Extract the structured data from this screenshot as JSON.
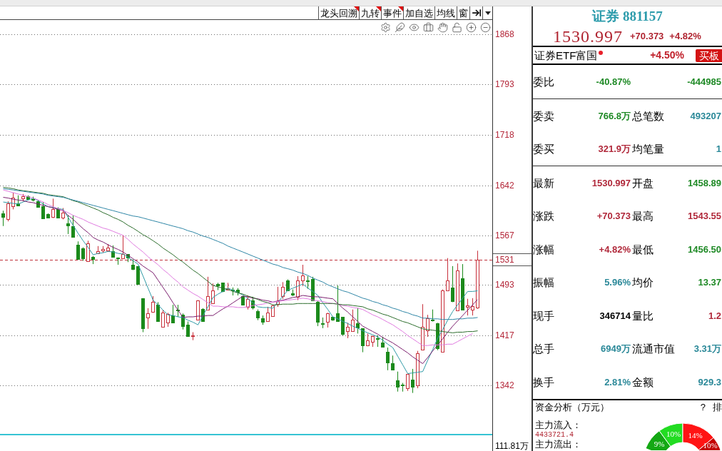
{
  "toolbar": [
    {
      "label": "龙头回溯",
      "corner_mark": true
    },
    {
      "label": "九转",
      "corner_mark": true
    },
    {
      "label": "事件",
      "corner_mark": true
    },
    {
      "label": "加自选",
      "corner_mark": false
    },
    {
      "label": "均线",
      "corner_mark": false
    },
    {
      "label": "窗",
      "corner_mark": false
    }
  ],
  "chart": {
    "chart_data": [
      {
        "type": "candlestick",
        "categories": [
          null,
          null,
          null,
          null,
          null,
          null,
          null,
          null,
          null,
          null,
          null,
          null,
          null,
          null,
          null,
          null,
          null,
          null,
          null,
          null,
          null,
          null,
          null,
          null,
          null,
          null,
          null,
          null,
          null,
          null,
          null,
          null,
          null,
          null,
          null,
          null,
          null,
          null,
          null,
          null,
          null,
          null,
          null,
          null,
          null,
          null,
          null,
          null,
          null,
          null,
          null,
          null,
          null,
          null,
          null,
          null,
          null,
          null,
          null,
          null,
          null,
          null,
          null,
          null,
          null,
          null,
          null,
          null,
          null,
          null,
          null,
          null,
          null,
          null,
          null,
          null,
          null,
          null,
          null,
          null,
          null,
          null,
          null,
          null,
          null,
          null,
          null,
          null,
          null,
          null,
          null,
          null,
          null,
          null,
          null,
          null
        ],
        "ylim": [
          1244,
          1910
        ],
        "yticks": [
          1342,
          1417,
          1493,
          1567,
          1642,
          1718,
          1793,
          1868
        ],
        "grid": true,
        "ohlc": [
          [
            1600,
            1604,
            1581,
            1595
          ],
          [
            1591,
            1618,
            1588,
            1615
          ],
          [
            1611,
            1631,
            1606,
            1623
          ],
          [
            1615,
            1627,
            1612,
            1612
          ],
          [
            1622,
            1629,
            1618,
            1626
          ],
          [
            1626,
            1627,
            1620,
            1621
          ],
          [
            1621,
            1625,
            1618,
            1620
          ],
          [
            1618,
            1620,
            1609,
            1610
          ],
          [
            1611,
            1617,
            1592,
            1592
          ],
          [
            1599,
            1600,
            1593,
            1594
          ],
          [
            1595,
            1622,
            1593,
            1606
          ],
          [
            1608,
            1609,
            1593,
            1594
          ],
          [
            1594,
            1608,
            1591,
            1601
          ],
          [
            1585,
            1597,
            1569,
            1582
          ],
          [
            1581,
            1597,
            1565,
            1565
          ],
          [
            1553,
            1558,
            1531,
            1532
          ],
          [
            1548,
            1549,
            1529,
            1533
          ],
          [
            1528,
            1559,
            1528,
            1555
          ],
          [
            1535,
            1536,
            1524,
            1532
          ],
          [
            1540,
            1551,
            1539,
            1543
          ],
          [
            1544,
            1551,
            1541,
            1546
          ],
          [
            1544,
            1554,
            1543,
            1549
          ],
          [
            1543,
            1552,
            1535,
            1535
          ],
          [
            1534,
            1534,
            1523,
            1533
          ],
          [
            1533,
            1567,
            1533,
            1539
          ],
          [
            1539,
            1539,
            1527,
            1534
          ],
          [
            1523,
            1531,
            1515,
            1517
          ],
          [
            1521,
            1521,
            1494,
            1494
          ],
          [
            1473,
            1473,
            1422,
            1428
          ],
          [
            1444,
            1458,
            1427,
            1450
          ],
          [
            1452,
            1476,
            1451,
            1467
          ],
          [
            1463,
            1467,
            1438,
            1439
          ],
          [
            1430,
            1455,
            1430,
            1451
          ],
          [
            1436,
            1451,
            1430,
            1449
          ],
          [
            1447,
            1463,
            1436,
            1436
          ],
          [
            1456,
            1463,
            1445,
            1455
          ],
          [
            1448,
            1450,
            1426,
            1431
          ],
          [
            1433,
            1438,
            1416,
            1416
          ],
          [
            1416,
            1422,
            1410,
            1417
          ],
          [
            1441,
            1470,
            1441,
            1470
          ],
          [
            1457,
            1458,
            1438,
            1439
          ],
          [
            1456,
            1505,
            1456,
            1476
          ],
          [
            1465,
            1495,
            1465,
            1484
          ],
          [
            1494,
            1496,
            1485,
            1492
          ],
          [
            1496,
            1496,
            1482,
            1483
          ],
          [
            1486,
            1496,
            1485,
            1488
          ],
          [
            1486,
            1489,
            1477,
            1485
          ],
          [
            1486,
            1488,
            1477,
            1482
          ],
          [
            1476,
            1477,
            1462,
            1463
          ],
          [
            1460,
            1477,
            1456,
            1472
          ],
          [
            1470,
            1475,
            1456,
            1459
          ],
          [
            1454,
            1456,
            1440,
            1444
          ],
          [
            1443,
            1447,
            1433,
            1438
          ],
          [
            1439,
            1460,
            1439,
            1451
          ],
          [
            1446,
            1463,
            1446,
            1462
          ],
          [
            1464,
            1490,
            1460,
            1469
          ],
          [
            1476,
            1497,
            1472,
            1490
          ],
          [
            1500,
            1501,
            1484,
            1485
          ],
          [
            1480,
            1486,
            1476,
            1478
          ],
          [
            1475,
            1506,
            1470,
            1500
          ],
          [
            1499,
            1523,
            1491,
            1507
          ],
          [
            1499,
            1506,
            1487,
            1498
          ],
          [
            1502,
            1505,
            1470,
            1470
          ],
          [
            1467,
            1469,
            1431,
            1438
          ],
          [
            1435,
            1444,
            1428,
            1434
          ],
          [
            1438,
            1451,
            1429,
            1450
          ],
          [
            1445,
            1445,
            1439,
            1441
          ],
          [
            1450,
            1492,
            1439,
            1439
          ],
          [
            1445,
            1445,
            1417,
            1419
          ],
          [
            1424,
            1436,
            1413,
            1430
          ],
          [
            1424,
            1456,
            1423,
            1441
          ],
          [
            1435,
            1458,
            1420,
            1429
          ],
          [
            1428,
            1428,
            1392,
            1402
          ],
          [
            1402,
            1420,
            1401,
            1410
          ],
          [
            1408,
            1417,
            1400,
            1416
          ],
          [
            1413,
            1417,
            1400,
            1412
          ],
          [
            1406,
            1415,
            1399,
            1400
          ],
          [
            1393,
            1399,
            1365,
            1377
          ],
          [
            1375,
            1387,
            1365,
            1366
          ],
          [
            1350,
            1363,
            1333,
            1340
          ],
          [
            1343,
            1346,
            1333,
            1342
          ],
          [
            1338,
            1359,
            1334,
            1359
          ],
          [
            1351,
            1367,
            1331,
            1340
          ],
          [
            1342,
            1394,
            1338,
            1390
          ],
          [
            1396,
            1464,
            1396,
            1430
          ],
          [
            1425,
            1448,
            1415,
            1443
          ],
          [
            1441,
            1456,
            1438,
            1440
          ],
          [
            1435,
            1436,
            1395,
            1398
          ],
          [
            1393,
            1486,
            1393,
            1485
          ],
          [
            1485,
            1533,
            1484,
            1499
          ],
          [
            1489,
            1521,
            1467,
            1469
          ],
          [
            1455,
            1525,
            1455,
            1514
          ],
          [
            1503,
            1524,
            1455,
            1456
          ],
          [
            1460,
            1472,
            1447,
            1462
          ],
          [
            1456,
            1473,
            1447,
            1461
          ],
          [
            1459,
            1544,
            1457,
            1531
          ]
        ],
        "series": [
          {
            "type": "line",
            "color": "#2f9aa6",
            "values": [
              1617,
              1616,
              1615,
              1614,
              1617,
              1620,
              1623,
              1619,
              1614,
              1610,
              1609,
              1607,
              1606,
              1594,
              1582,
              1570,
              1559,
              1549,
              1538,
              1540,
              1541,
              1543,
              1542,
              1540,
              1539,
              1534,
              1529,
              1524,
              1506,
              1488,
              1470,
              1463,
              1455,
              1448,
              1447,
              1445,
              1444,
              1440,
              1437,
              1433,
              1447,
              1460,
              1474,
              1479,
              1483,
              1488,
              1485,
              1481,
              1478,
              1472,
              1466,
              1460,
              1459,
              1459,
              1458,
              1467,
              1476,
              1485,
              1488,
              1491,
              1494,
              1488,
              1483,
              1477,
              1466,
              1456,
              1445,
              1442,
              1438,
              1435,
              1431,
              1428,
              1424,
              1421,
              1418,
              1415,
              1410,
              1404,
              1399,
              1386,
              1373,
              1360,
              1361,
              1362,
              1363,
              1380,
              1396,
              1413,
              1426,
              1440,
              1453,
              1463,
              1473,
              1483,
              1483,
              1484
            ]
          },
          {
            "type": "line",
            "color": "#7b1e6e",
            "values": [
              1624,
              1623,
              1621,
              1620,
              1619,
              1617,
              1616,
              1614,
              1612,
              1610,
              1608,
              1606,
              1604,
              1597,
              1591,
              1584,
              1577,
              1571,
              1564,
              1560,
              1557,
              1553,
              1549,
              1546,
              1542,
              1537,
              1532,
              1527,
              1521,
              1516,
              1511,
              1500,
              1489,
              1478,
              1466,
              1455,
              1444,
              1445,
              1445,
              1446,
              1446,
              1447,
              1447,
              1452,
              1457,
              1461,
              1466,
              1471,
              1476,
              1475,
              1473,
              1472,
              1470,
              1469,
              1467,
              1469,
              1470,
              1472,
              1474,
              1475,
              1477,
              1476,
              1475,
              1475,
              1474,
              1473,
              1472,
              1465,
              1458,
              1452,
              1445,
              1438,
              1431,
              1427,
              1423,
              1419,
              1414,
              1410,
              1406,
              1401,
              1396,
              1391,
              1385,
              1380,
              1375,
              1384,
              1394,
              1403,
              1412,
              1422,
              1431,
              1439,
              1447,
              1455,
              1463,
              1471
            ]
          },
          {
            "type": "line",
            "color": "#e07ae0",
            "values": [
              1635,
              1633,
              1631,
              1629,
              1627,
              1625,
              1623,
              1620,
              1617,
              1613,
              1610,
              1607,
              1604,
              1601,
              1597,
              1594,
              1591,
              1587,
              1584,
              1581,
              1578,
              1576,
              1573,
              1570,
              1567,
              1561,
              1554,
              1548,
              1542,
              1535,
              1529,
              1523,
              1516,
              1510,
              1503,
              1497,
              1490,
              1485,
              1480,
              1476,
              1471,
              1466,
              1461,
              1461,
              1460,
              1460,
              1460,
              1459,
              1459,
              1460,
              1462,
              1463,
              1464,
              1466,
              1467,
              1468,
              1469,
              1470,
              1471,
              1472,
              1473,
              1472,
              1470,
              1469,
              1468,
              1466,
              1465,
              1464,
              1462,
              1461,
              1459,
              1458,
              1456,
              1452,
              1448,
              1445,
              1441,
              1437,
              1433,
              1428,
              1423,
              1417,
              1412,
              1407,
              1402,
              1402,
              1403,
              1403,
              1403,
              1404,
              1404,
              1408,
              1412,
              1416,
              1420,
              null
            ]
          },
          {
            "type": "line",
            "color": "#2d6e2d",
            "values": [
              1639,
              1638,
              1637,
              1635,
              1634,
              1633,
              1632,
              1631,
              1630,
              1628,
              1627,
              1626,
              1625,
              1622,
              1619,
              1617,
              1614,
              1611,
              1608,
              1605,
              1601,
              1598,
              1594,
              1591,
              1587,
              1582,
              1578,
              1573,
              1568,
              1564,
              1559,
              1554,
              1548,
              1543,
              1538,
              1532,
              1527,
              1521,
              1515,
              1510,
              1504,
              1498,
              1492,
              1490,
              1488,
              1486,
              1483,
              1481,
              1479,
              1476,
              1474,
              1471,
              1468,
              1466,
              1463,
              1463,
              1464,
              1464,
              1464,
              1465,
              1465,
              1465,
              1465,
              1465,
              1465,
              1465,
              1465,
              1464,
              1463,
              1463,
              1462,
              1461,
              1460,
              1457,
              1455,
              1452,
              1449,
              1447,
              1444,
              1441,
              1438,
              1436,
              1433,
              1430,
              1427,
              1426,
              1425,
              1424,
              1423,
              1422,
              1421,
              1422,
              1422,
              1423,
              1423,
              1424
            ]
          },
          {
            "type": "line",
            "color": "#2e86a6",
            "values": [
              1637,
              1636,
              1635,
              1634,
              1633,
              1632,
              1631,
              1630,
              1629,
              1627,
              1626,
              1625,
              1624,
              1622,
              1620,
              1618,
              1616,
              1614,
              1612,
              1610,
              1608,
              1606,
              1604,
              1602,
              1600,
              1598,
              1596,
              1595,
              1593,
              1591,
              1589,
              1587,
              1585,
              1583,
              1581,
              1579,
              1577,
              1574,
              1572,
              1569,
              1566,
              1564,
              1561,
              1558,
              1555,
              1551,
              1548,
              1545,
              1542,
              1539,
              1536,
              1533,
              1530,
              1527,
              1524,
              1522,
              1519,
              1517,
              1515,
              1512,
              1510,
              1507,
              1503,
              1500,
              1497,
              1493,
              1490,
              1487,
              1484,
              1482,
              1479,
              1476,
              1473,
              1471,
              1468,
              1466,
              1463,
              1461,
              1458,
              1456,
              1453,
              1451,
              1448,
              1446,
              1443,
              1443,
              1442,
              1442,
              1441,
              1441,
              1441,
              1442,
              1442,
              1443,
              1443,
              1444
            ]
          }
        ],
        "ref_lines": [
          {
            "axis": "y",
            "value": 1531,
            "label": "1531",
            "color": "#c0303a",
            "line_style": "dashed"
          }
        ]
      }
    ],
    "volume_axis_label": "111.81万"
  },
  "header": {
    "title": "证券 881157",
    "price": "1530.997",
    "change": "+70.373",
    "change_pct": "+4.82%"
  },
  "etf": {
    "name": "证券ETF富国",
    "change": "+4.50%",
    "button": "买板"
  },
  "sections": [
    {
      "rows": [
        {
          "label": "委比",
          "value": {
            "text": "-40.87%",
            "color": "#1f8a26"
          },
          "value_2": {
            "text": "-444985",
            "color": "#1f8a26"
          }
        }
      ]
    },
    {
      "rows": [
        {
          "label": "委卖",
          "value": {
            "text": "766.8万",
            "color": "#1f8a26"
          },
          "label_2": "总笔数",
          "value_2": {
            "text": "493207",
            "color": "#2a8898"
          }
        },
        {
          "label": "委买",
          "value": {
            "text": "321.9万",
            "color": "#b0283a"
          },
          "label_2": "均笔量",
          "value_2": {
            "text": "1",
            "color": "#2a8898"
          }
        }
      ]
    },
    {
      "rows": [
        {
          "label": "最新",
          "value": {
            "text": "1530.997",
            "color": "#b0283a"
          },
          "label_2": "开盘",
          "value_2": {
            "text": "1458.89",
            "color": "#1f8a26"
          }
        },
        {
          "label": "涨跌",
          "value": {
            "text": "+70.373",
            "color": "#b0283a"
          },
          "label_2": "最高",
          "value_2": {
            "text": "1543.55",
            "color": "#b0283a"
          }
        },
        {
          "label": "涨幅",
          "value": {
            "text": "+4.82%",
            "color": "#b0283a"
          },
          "label_2": "最低",
          "value_2": {
            "text": "1456.50",
            "color": "#1f8a26"
          }
        },
        {
          "label": "振幅",
          "value": {
            "text": "5.96%",
            "color": "#2a8898"
          },
          "label_2": "均价",
          "value_2": {
            "text": "13.37",
            "color": "#1f8a26"
          }
        },
        {
          "label": "现手",
          "value": {
            "text": "346714",
            "color": "#000000"
          },
          "label_2": "量比",
          "value_2": {
            "text": "1.2",
            "color": "#b0283a"
          }
        },
        {
          "label": "总手",
          "value": {
            "text": "6949万",
            "color": "#2a8898"
          },
          "label_2": "流通市值",
          "value_2": {
            "text": "3.31万",
            "color": "#2a8898"
          }
        },
        {
          "label": "换手",
          "value": {
            "text": "2.81%",
            "color": "#2a8898"
          },
          "label_2": "金额",
          "value_2": {
            "text": "929.3",
            "color": "#2a8898"
          }
        }
      ]
    }
  ],
  "fund_flow": {
    "title": "资金分析（万元）",
    "help": "?",
    "sort": "排",
    "inflow_label": "主力流入：",
    "inflow_value": "4433721.4",
    "outflow_label": "主力流出：",
    "chart_data": [
      {
        "type": "donut",
        "categories": [
          null,
          null,
          null,
          null
        ],
        "values": [
          9,
          10,
          14,
          10
        ],
        "colors": [
          "#14a814",
          "#22dc22",
          "#ff1414",
          "#c40000"
        ],
        "value_labels": [
          "9%",
          "10%",
          "14%",
          "10%"
        ]
      }
    ]
  }
}
